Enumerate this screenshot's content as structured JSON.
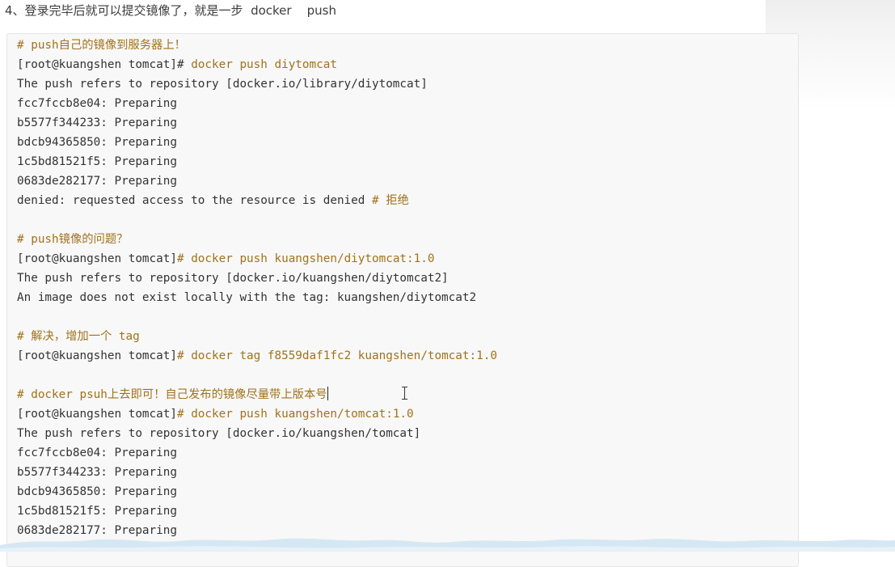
{
  "heading": "4、登录完毕后就可以提交镜像了，就是一步  docker    push",
  "code_lines": [
    [
      {
        "t": "# push自己的镜像到服务器上！",
        "k": "comment"
      }
    ],
    [
      {
        "t": "[root@kuangshen tomcat]# ",
        "k": "prompt"
      },
      {
        "t": "docker push diytomcat",
        "k": "cmd"
      }
    ],
    [
      {
        "t": "The push refers to repository [docker.io/library/diytomcat]",
        "k": "text"
      }
    ],
    [
      {
        "t": "fcc7fccb8e04: Preparing",
        "k": "text"
      }
    ],
    [
      {
        "t": "b5577f344233: Preparing",
        "k": "text"
      }
    ],
    [
      {
        "t": "bdcb94365850: Preparing",
        "k": "text"
      }
    ],
    [
      {
        "t": "1c5bd81521f5: Preparing",
        "k": "text"
      }
    ],
    [
      {
        "t": "0683de282177: Preparing",
        "k": "text"
      }
    ],
    [
      {
        "t": "denied: requested access to the resource is denied ",
        "k": "text"
      },
      {
        "t": "# 拒绝",
        "k": "comment"
      }
    ],
    [],
    [
      {
        "t": "# push镜像的问题？",
        "k": "comment"
      }
    ],
    [
      {
        "t": "[root@kuangshen tomcat]",
        "k": "prompt"
      },
      {
        "t": "# docker push kuangshen/diytomcat:1.0",
        "k": "comment"
      }
    ],
    [
      {
        "t": "The push refers to repository [docker.io/kuangshen/diytomcat2]",
        "k": "text"
      }
    ],
    [
      {
        "t": "An image does not exist locally with the tag: kuangshen/diytomcat2",
        "k": "text"
      }
    ],
    [],
    [
      {
        "t": "# 解决，增加一个 tag",
        "k": "comment"
      }
    ],
    [
      {
        "t": "[root@kuangshen tomcat]",
        "k": "prompt"
      },
      {
        "t": "# docker tag f8559daf1fc2 kuangshen/tomcat:1.0",
        "k": "comment"
      }
    ],
    [],
    [
      {
        "t": "# docker psuh上去即可！自己发布的镜像尽量带上版本号",
        "k": "comment"
      }
    ],
    [
      {
        "t": "[root@kuangshen tomcat]",
        "k": "prompt"
      },
      {
        "t": "# docker push kuangshen/tomcat:1.0",
        "k": "comment"
      }
    ],
    [
      {
        "t": "The push refers to repository [docker.io/kuangshen/tomcat]",
        "k": "text"
      }
    ],
    [
      {
        "t": "fcc7fccb8e04: Preparing",
        "k": "text"
      }
    ],
    [
      {
        "t": "b5577f344233: Preparing",
        "k": "text"
      }
    ],
    [
      {
        "t": "bdcb94365850: Preparing",
        "k": "text"
      }
    ],
    [
      {
        "t": "1c5bd81521f5: Preparing",
        "k": "text"
      }
    ],
    [
      {
        "t": "0683de282177: Preparing",
        "k": "text"
      }
    ]
  ],
  "caret_line_index": 18,
  "colors": {
    "comment": "#a0721c",
    "text": "#333333",
    "code_background": "#f8f8f8",
    "wave": "#d5e7f3"
  },
  "icons": {
    "cursor": "text-cursor-icon"
  }
}
